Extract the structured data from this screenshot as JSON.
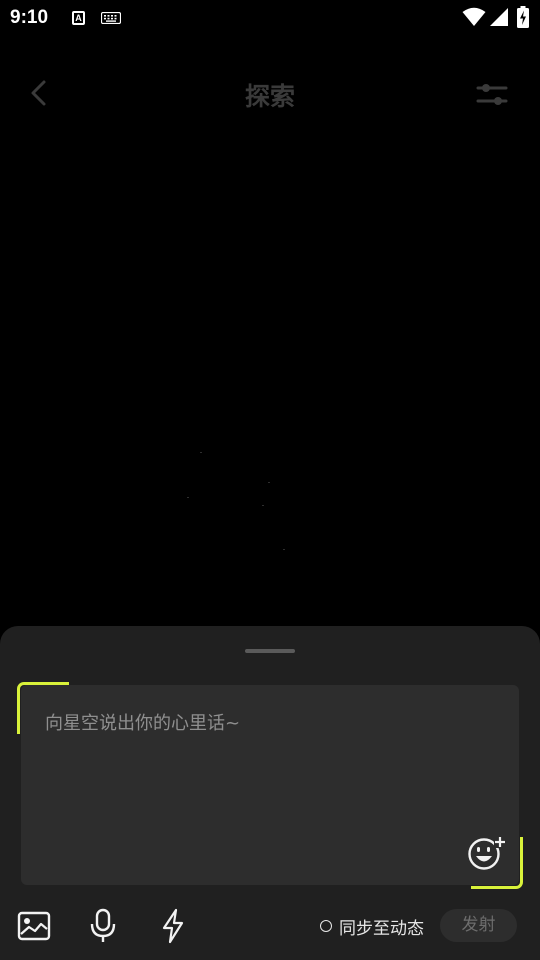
{
  "status_bar": {
    "time": "9:10",
    "a_icon_letter": "A",
    "icons": [
      "a-icon",
      "keyboard-icon",
      "wifi-icon",
      "signal-icon",
      "battery-charging-icon"
    ]
  },
  "header": {
    "title": "探索",
    "back_icon": "chevron-left-icon",
    "filter_icon": "sliders-icon"
  },
  "composer": {
    "placeholder": "向星空说出你的心里话~",
    "value": "",
    "emoji_icon": "emoji-add-icon",
    "accent_color": "#d9f23a"
  },
  "toolbar": {
    "icons": [
      "image-icon",
      "microphone-icon",
      "lightning-icon"
    ],
    "sync_label": "同步至动态",
    "sync_checked": false,
    "send_label": "发射"
  },
  "colors": {
    "background": "#000000",
    "sheet": "#202020",
    "input": "#2d2d2d",
    "accent": "#d9f23a"
  }
}
